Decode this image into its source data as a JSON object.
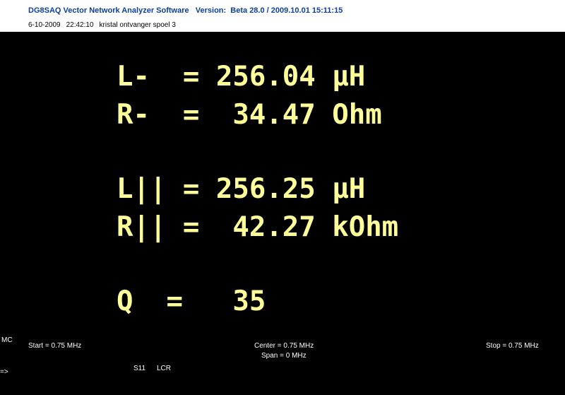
{
  "header": {
    "title": "DG8SAQ Vector Network Analyzer Software   Version:  Beta 28.0 / 2009.10.01 15:11:15",
    "date": "6-10-2009",
    "time": "22:42:10",
    "description": "kristal ontvanger spoel 3"
  },
  "readouts": {
    "l_series": "L-  = 256.04 µH",
    "r_series": "R-  =  34.47 Ohm",
    "l_parallel": "L|| = 256.25 µH",
    "r_parallel": "R|| =  42.27 kOhm",
    "q": "Q  =   35"
  },
  "footer": {
    "mc": "MC",
    "start": "Start = 0.75 MHz",
    "center": "Center = 0.75 MHz",
    "span": "Span = 0 MHz",
    "stop": "Stop = 0.75 MHz",
    "s11": "S11",
    "lcr": "LCR",
    "arrow": "=>"
  },
  "colors": {
    "background": "#000000",
    "readout": "#ffff99",
    "title": "#0b3f9a"
  }
}
